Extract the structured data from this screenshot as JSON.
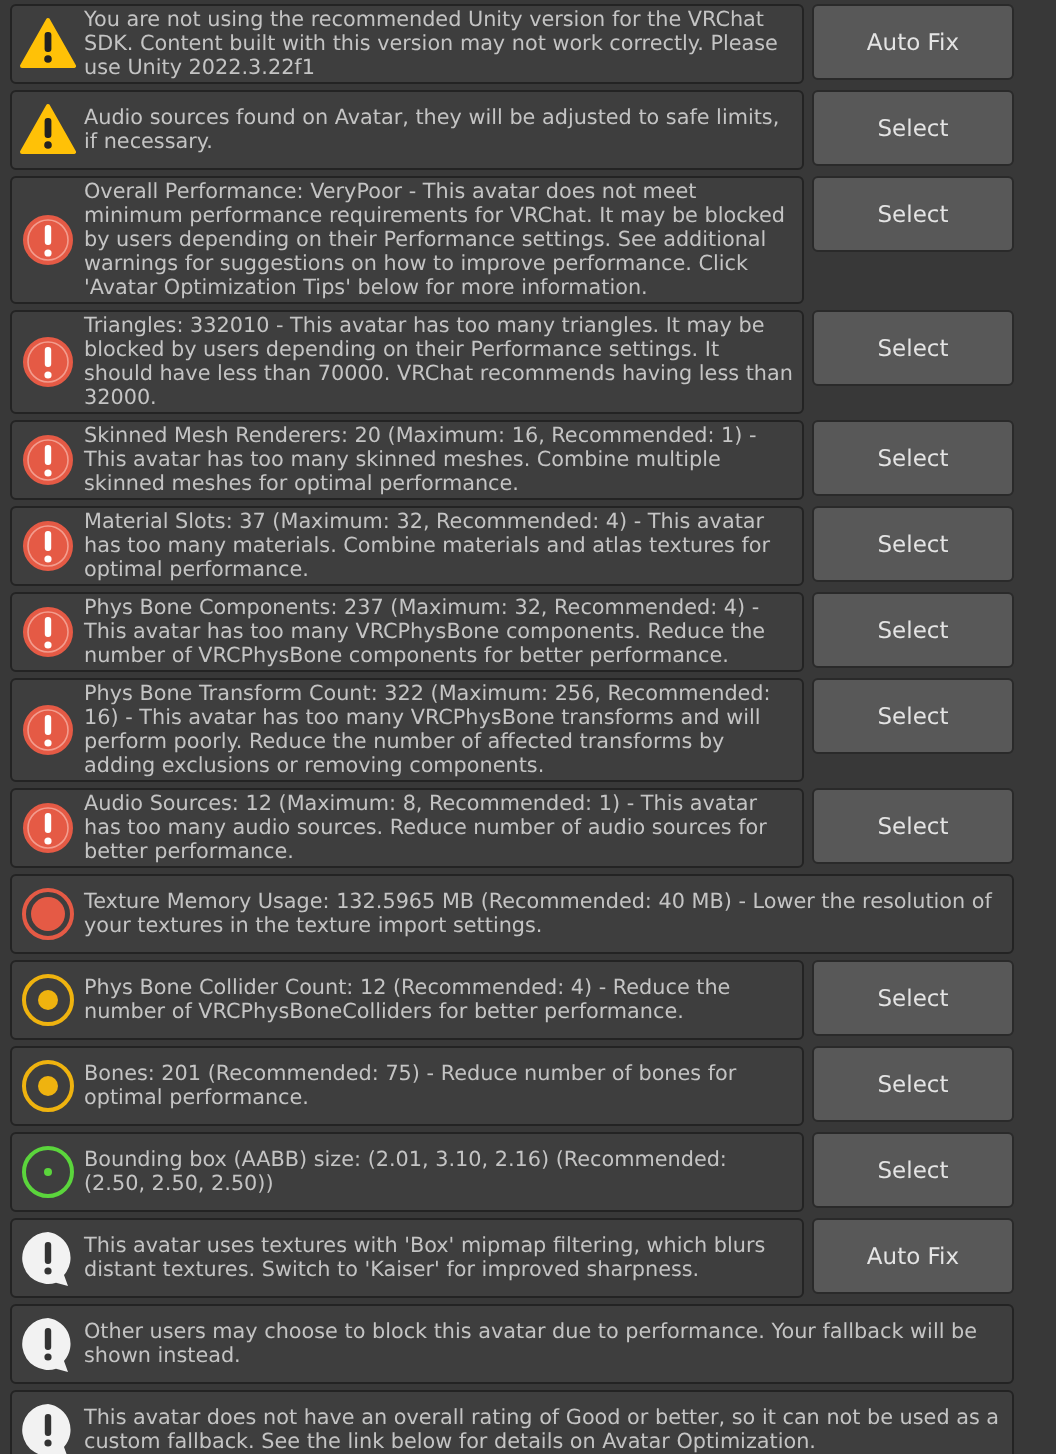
{
  "messages": [
    {
      "kind": "warning",
      "text": "You are not using the recommended Unity version for the VRChat SDK. Content built with this version may not work correctly. Please use Unity 2022.3.22f1",
      "button": "Auto Fix"
    },
    {
      "kind": "warning",
      "text": "Audio sources found on Avatar, they will be adjusted to safe limits, if necessary.",
      "button": "Select"
    },
    {
      "kind": "error",
      "text": "Overall Performance: VeryPoor - This avatar does not meet minimum performance requirements for VRChat. It may be blocked by users depending on their Performance settings. See additional warnings for suggestions on how to improve performance. Click 'Avatar Optimization Tips' below for more information.",
      "button": "Select"
    },
    {
      "kind": "error",
      "text": "Triangles: 332010 - This avatar has too many triangles. It may be blocked by users depending on their Performance settings. It should have less than 70000. VRChat recommends having less than 32000.",
      "button": "Select"
    },
    {
      "kind": "error",
      "text": "Skinned Mesh Renderers: 20 (Maximum: 16, Recommended: 1) - This avatar has too many skinned meshes. Combine multiple skinned meshes for optimal performance.",
      "button": "Select"
    },
    {
      "kind": "error",
      "text": "Material Slots: 37 (Maximum: 32, Recommended: 4) - This avatar has too many materials. Combine materials and atlas textures for optimal performance.",
      "button": "Select"
    },
    {
      "kind": "error",
      "text": "Phys Bone Components: 237 (Maximum: 32, Recommended: 4) - This avatar has too many VRCPhysBone components. Reduce the number of VRCPhysBone components for better performance.",
      "button": "Select"
    },
    {
      "kind": "error",
      "text": "Phys Bone Transform Count: 322 (Maximum: 256, Recommended: 16) - This avatar has too many VRCPhysBone transforms and will perform poorly. Reduce the number of affected transforms by adding exclusions or removing components.",
      "button": "Select"
    },
    {
      "kind": "error",
      "text": "Audio Sources: 12 (Maximum: 8, Recommended: 1) - This avatar has too many audio sources. Reduce number of audio sources for better performance.",
      "button": "Select"
    },
    {
      "kind": "verypoor",
      "text": "Texture Memory Usage: 132.5965 MB (Recommended: 40 MB) - Lower the resolution of your textures in the texture import settings."
    },
    {
      "kind": "poor",
      "text": "Phys Bone Collider Count: 12 (Recommended: 4) - Reduce the number of VRCPhysBoneColliders for better performance.",
      "button": "Select"
    },
    {
      "kind": "poor",
      "text": "Bones: 201 (Recommended: 75) - Reduce number of bones for optimal performance.",
      "button": "Select"
    },
    {
      "kind": "good",
      "text": "Bounding box (AABB) size: (2.01, 3.10, 2.16) (Recommended: (2.50, 2.50, 2.50))",
      "button": "Select"
    },
    {
      "kind": "info",
      "text": "This avatar uses textures with 'Box' mipmap filtering, which blurs distant textures. Switch to 'Kaiser' for improved sharpness.",
      "button": "Auto Fix"
    },
    {
      "kind": "info",
      "text": "Other users may choose to block this avatar due to performance. Your fallback will be shown instead."
    },
    {
      "kind": "info",
      "text": "This avatar does not have an overall rating of Good or better, so it can not be used as a custom fallback. See the link below for details on Avatar Optimization."
    }
  ]
}
